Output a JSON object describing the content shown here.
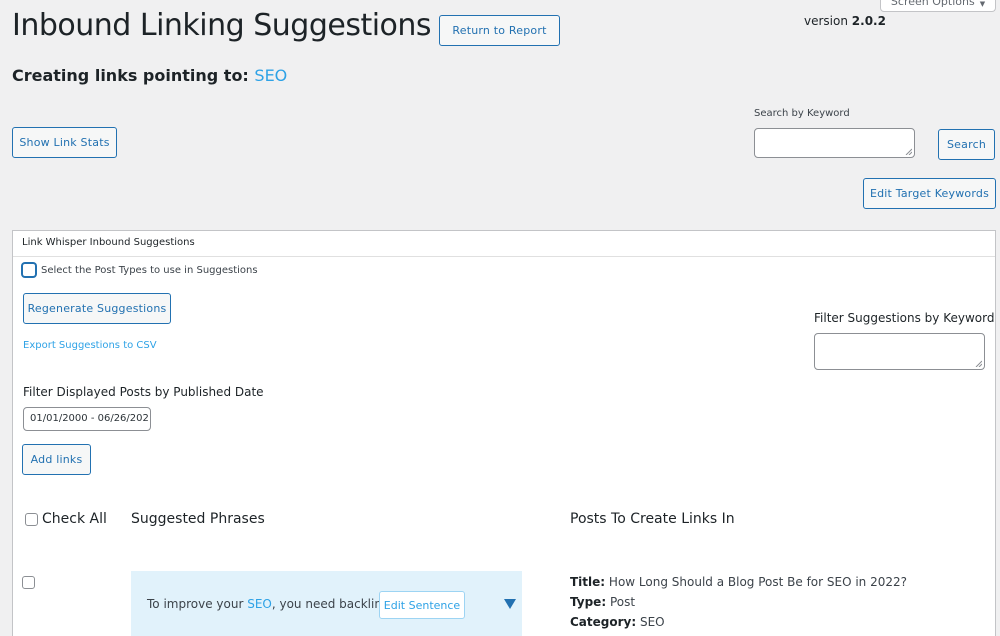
{
  "header": {
    "title": "Inbound Linking Suggestions",
    "return_button": "Return to Report",
    "version_label": "version",
    "version_number": "2.0.2",
    "screen_options": "Screen Options"
  },
  "subtitle": {
    "prefix": "Creating links pointing to:",
    "target": "SEO"
  },
  "toolbar": {
    "show_stats": "Show Link Stats",
    "search_label": "Search by Keyword",
    "search_value": "",
    "search_button": "Search",
    "edit_keywords": "Edit Target Keywords"
  },
  "panel": {
    "title": "Link Whisper Inbound Suggestions",
    "post_types_label": "Select the Post Types to use in Suggestions",
    "regenerate": "Regenerate Suggestions",
    "export_csv": "Export Suggestions to CSV",
    "filter_keyword_label": "Filter Suggestions by Keyword",
    "filter_keyword_value": "",
    "date_filter_label": "Filter Displayed Posts by Published Date",
    "date_range": "01/01/2000 - 06/26/202",
    "add_links": "Add links"
  },
  "table": {
    "check_all": "Check All",
    "col_phrases": "Suggested Phrases",
    "col_posts": "Posts To Create Links In",
    "rows": [
      {
        "phrase_before": "To improve your ",
        "phrase_link": "SEO",
        "phrase_after": ", you need backlinks",
        "edit_sentence": "Edit Sentence",
        "title_label": "Title:",
        "title": "How Long Should a Blog Post Be for SEO in 2022?",
        "type_label": "Type:",
        "type": "Post",
        "category_label": "Category:",
        "category": "SEO"
      }
    ]
  },
  "colors": {
    "accent": "#2271b1",
    "link": "#2ea2e6",
    "suggestion_bg": "#e1f2fb"
  }
}
